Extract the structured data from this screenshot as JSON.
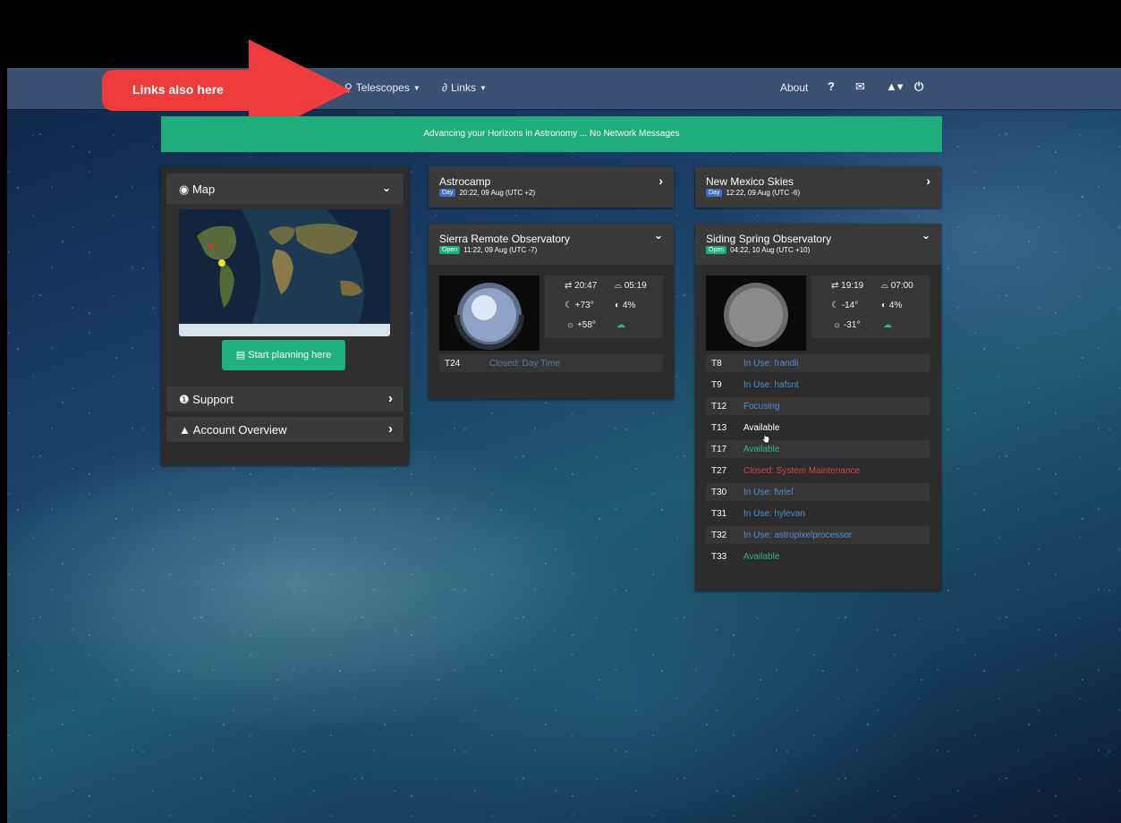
{
  "callout": {
    "text": "Links also here",
    "color": "#ee3b3b"
  },
  "navbar": {
    "telescopes_label": "Telescopes",
    "links_label": "Links",
    "about_label": "About",
    "icons": [
      "telescope-icon",
      "link-icon",
      "help-icon",
      "mail-icon",
      "user-icon",
      "power-icon"
    ]
  },
  "banner": {
    "text": "Advancing your Horizons in Astronomy ... No Network Messages",
    "color": "#1fae7b"
  },
  "left_panel": {
    "map_label": "Map",
    "start_planning_label": "Start planning here",
    "support_label": "Support",
    "account_label": "Account Overview"
  },
  "observatories": {
    "astrocamp": {
      "name": "Astrocamp",
      "badge": "Day",
      "time": "20:22, 09 Aug (UTC +2)"
    },
    "nm_skies": {
      "name": "New Mexico Skies",
      "badge": "Day",
      "time": "12:22, 09 Aug (UTC -6)"
    },
    "sierra": {
      "name": "Sierra Remote Observatory",
      "badge": "Open",
      "time": "11:22, 09 Aug (UTC -7)",
      "sunset": "20:47",
      "sunrise": "05:19",
      "moon_alt": "+73°",
      "moon_phase": "4%",
      "sun_alt": "+58°",
      "telescopes": [
        {
          "id": "T24",
          "status": "Closed: Day Time"
        }
      ]
    },
    "siding": {
      "name": "Siding Spring Observatory",
      "badge": "Open",
      "time": "04:22, 10 Aug (UTC +10)",
      "sunset": "19:19",
      "sunrise": "07:00",
      "moon_alt": "-14°",
      "moon_phase": "4%",
      "sun_alt": "-31°",
      "telescopes": [
        {
          "id": "T8",
          "status": "In Use: frandli"
        },
        {
          "id": "T9",
          "status": "In Use: hafsnt"
        },
        {
          "id": "T12",
          "status": "Focusing"
        },
        {
          "id": "T13",
          "status": "Available"
        },
        {
          "id": "T17",
          "status": "Available"
        },
        {
          "id": "T27",
          "status": "Closed: System Maintenance"
        },
        {
          "id": "T30",
          "status": "In Use: fvriel"
        },
        {
          "id": "T31",
          "status": "In Use: hylevan"
        },
        {
          "id": "T32",
          "status": "In Use: astropixelprocessor"
        },
        {
          "id": "T33",
          "status": "Available"
        }
      ]
    }
  }
}
